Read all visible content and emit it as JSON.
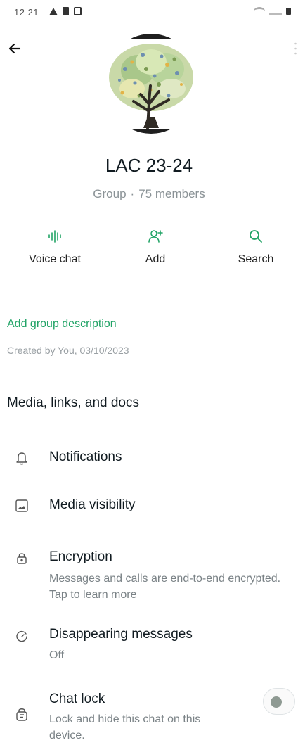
{
  "status_bar": {
    "time": "12 21"
  },
  "group": {
    "name": "LAC 23-24",
    "type": "Group",
    "members": "75 members"
  },
  "actions": [
    {
      "label": "Voice chat",
      "icon": "voice-wave-icon"
    },
    {
      "label": "Add",
      "icon": "add-person-icon"
    },
    {
      "label": "Search",
      "icon": "search-icon"
    }
  ],
  "description": {
    "add_label": "Add group description",
    "created_by": "Created by You, 03/10/2023"
  },
  "media": {
    "label": "Media, links, and docs"
  },
  "settings": {
    "notifications": {
      "title": "Notifications",
      "icon": "bell-icon"
    },
    "media_visibility": {
      "title": "Media visibility",
      "icon": "image-icon"
    },
    "encryption": {
      "title": "Encryption",
      "description": "Messages and calls are end-to-end encrypted. Tap to learn more",
      "icon": "lock-icon"
    },
    "disappearing": {
      "title": "Disappearing messages",
      "value": "Off",
      "icon": "timer-icon"
    },
    "chat_lock": {
      "title": "Chat lock",
      "description": "Lock and hide this chat on this device.",
      "icon": "chat-lock-icon",
      "enabled": false
    }
  },
  "colors": {
    "accent": "#21a366",
    "text_primary": "#111b21",
    "text_secondary": "#7a8286"
  }
}
